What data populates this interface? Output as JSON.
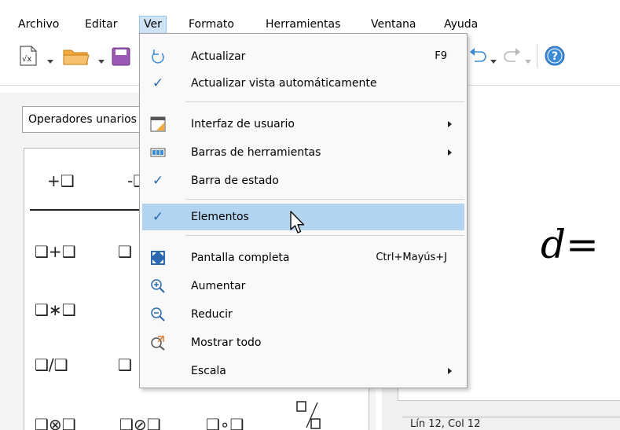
{
  "menubar": {
    "items": [
      {
        "label": "Archivo"
      },
      {
        "label": "Editar"
      },
      {
        "label": "Ver"
      },
      {
        "label": "Formato"
      },
      {
        "label": "Herramientas"
      },
      {
        "label": "Ventana"
      },
      {
        "label": "Ayuda"
      }
    ]
  },
  "elements_panel": {
    "category": "Operadores unarios",
    "row1": [
      "+❑",
      "-❑"
    ],
    "row2": [
      "❑+❑",
      "❑"
    ],
    "row3": [
      "❑∗❑"
    ],
    "row4": [
      "❑/❑",
      "❑"
    ],
    "row5": [
      "❑⊗❑",
      "❑⊘❑",
      "❑∘❑"
    ]
  },
  "formula": {
    "variable": "d",
    "operator": "="
  },
  "status": {
    "text": "Lín 12, Col 12"
  },
  "ver_menu": {
    "actualizar": {
      "label": "Actualizar",
      "shortcut": "F9"
    },
    "actualizar_auto": {
      "label": "Actualizar vista automáticamente"
    },
    "interfaz": {
      "label": "Interfaz de usuario"
    },
    "barras": {
      "label": "Barras de herramientas"
    },
    "barra_estado": {
      "label": "Barra de estado"
    },
    "elementos": {
      "label": "Elementos"
    },
    "pantalla_completa": {
      "label": "Pantalla completa",
      "shortcut": "Ctrl+Mayús+J"
    },
    "aumentar": {
      "label": "Aumentar"
    },
    "reducir": {
      "label": "Reducir"
    },
    "mostrar_todo": {
      "label": "Mostrar todo"
    },
    "escala": {
      "label": "Escala"
    }
  },
  "colors": {
    "highlight": "#b3d4f0",
    "active_menu": "#cfe3f6",
    "accent_blue": "#2a6ab0",
    "folder_orange": "#f3a93c",
    "help_blue": "#3a8ad8"
  }
}
